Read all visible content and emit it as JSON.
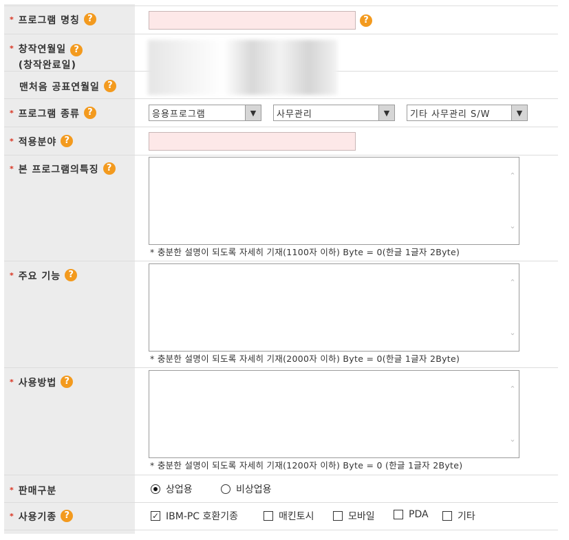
{
  "rows": {
    "program_name": {
      "label": "프로그램 명칭"
    },
    "creation_date": {
      "label": "창작연월일",
      "sub": "(창작완료일)"
    },
    "first_publication": {
      "label": "맨처음 공표연월일"
    },
    "program_type": {
      "label": "프로그램 종류",
      "select1": "응용프로그램",
      "select2": "사무관리",
      "select3": "기타 사무관리 S/W"
    },
    "application_field": {
      "label": "적용분야"
    },
    "features": {
      "label": "본 프로그램의특징",
      "note": "* 충분한 설명이 되도록 자세히 기재(1100자 이하) Byte = 0(한글 1글자 2Byte)"
    },
    "main_functions": {
      "label": "주요 기능",
      "note": "* 충분한 설명이 되도록 자세히 기재(2000자 이하) Byte = 0(한글 1글자 2Byte)"
    },
    "usage": {
      "label": "사용방법",
      "note": "* 충분한 설명이 되도록 자세히 기재(1200자 이하) Byte = 0 (한글 1글자 2Byte)"
    },
    "sales_type": {
      "label": "판매구분",
      "options": [
        {
          "label": "상업용",
          "selected": true
        },
        {
          "label": "비상업용",
          "selected": false
        }
      ]
    },
    "machine_type": {
      "label": "사용기종",
      "options": [
        {
          "label": "IBM-PC 호환기종",
          "checked": true
        },
        {
          "label": "매킨토시",
          "checked": false
        },
        {
          "label": "모바일",
          "checked": false
        },
        {
          "label": "PDA",
          "checked": false
        },
        {
          "label": "기타",
          "checked": false
        }
      ]
    }
  },
  "help_icon": "?",
  "required_mark": "*",
  "accent_color": "#f39a1e",
  "required_color": "#d9321f"
}
